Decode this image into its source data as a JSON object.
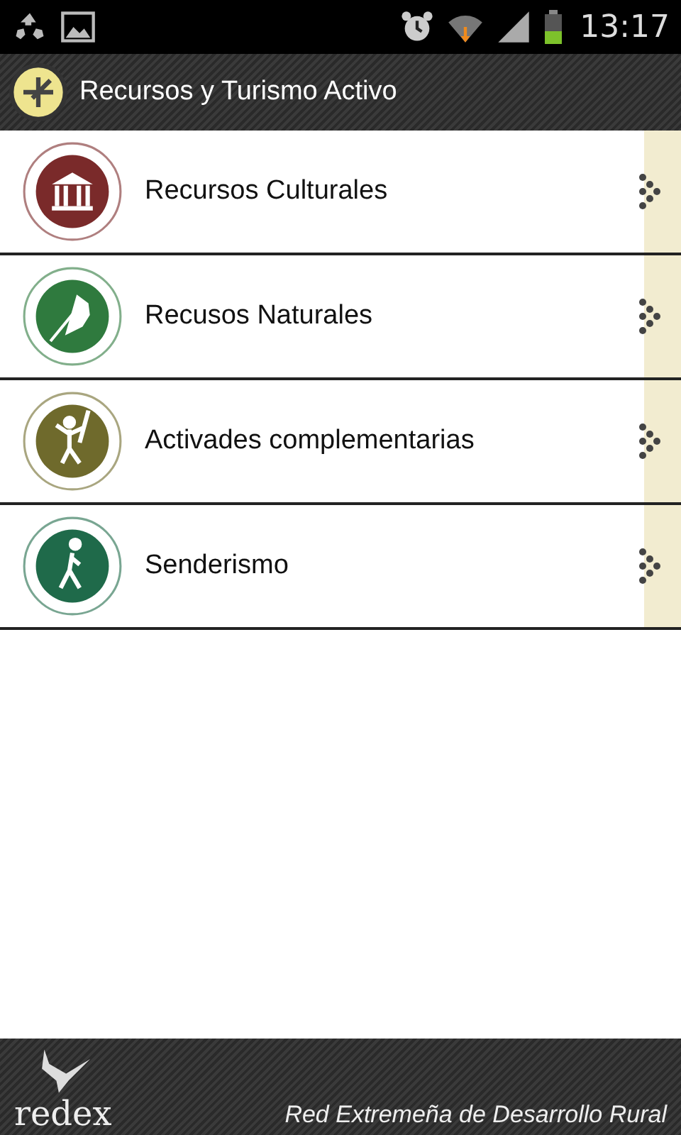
{
  "status_bar": {
    "time": "13:17"
  },
  "action_bar": {
    "title": "Recursos y Turismo Activo"
  },
  "items": [
    {
      "label": "Recursos Culturales",
      "kind": "culture",
      "color": "#7a2a2a"
    },
    {
      "label": "Recusos Naturales",
      "kind": "nature",
      "color": "#2f7a3e"
    },
    {
      "label": "Activades complementarias",
      "kind": "climbing",
      "color": "#6f6a2c"
    },
    {
      "label": "Senderismo",
      "kind": "hiking",
      "color": "#1f6a4a"
    }
  ],
  "footer": {
    "logo": "redex",
    "tagline": "Red Extremeña de Desarrollo Rural"
  }
}
